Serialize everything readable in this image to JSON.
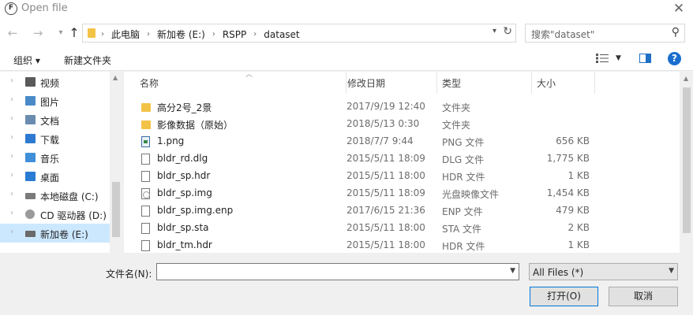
{
  "window": {
    "title": "Open file",
    "icon": "app-icon"
  },
  "address": {
    "crumbs": [
      "此电脑",
      "新加卷 (E:)",
      "RSPP",
      "dataset"
    ],
    "search_placeholder": "搜索\"dataset\""
  },
  "toolbar": {
    "organize": "组织 ▾",
    "new_folder": "新建文件夹"
  },
  "nav": {
    "items": [
      {
        "label": "视频",
        "icon": "video-folder-icon",
        "color": "#5a5a5a"
      },
      {
        "label": "图片",
        "icon": "pictures-folder-icon",
        "color": "#4a8ac9"
      },
      {
        "label": "文档",
        "icon": "documents-folder-icon",
        "color": "#6a8caf"
      },
      {
        "label": "下载",
        "icon": "downloads-folder-icon",
        "color": "#2f7ad1"
      },
      {
        "label": "音乐",
        "icon": "music-folder-icon",
        "color": "#3f8fd9"
      },
      {
        "label": "桌面",
        "icon": "desktop-folder-icon",
        "color": "#2a7bd3"
      },
      {
        "label": "本地磁盘 (C:)",
        "icon": "drive-c-icon",
        "color": "#7a7a7a"
      },
      {
        "label": "CD 驱动器 (D:)",
        "icon": "cd-drive-icon",
        "color": "#9a9a9a"
      },
      {
        "label": "新加卷 (E:)",
        "icon": "drive-e-icon",
        "color": "#6a6a6a"
      }
    ],
    "selected": "新加卷 (E:)"
  },
  "files": {
    "columns": [
      "名称",
      "修改日期",
      "类型",
      "大小"
    ],
    "rows": [
      {
        "name": "高分2号_2景",
        "date": "2017/9/19 12:40",
        "type": "文件夹",
        "size": "",
        "icon": "folder"
      },
      {
        "name": "影像数据（原始）",
        "date": "2018/5/13 0:30",
        "type": "文件夹",
        "size": "",
        "icon": "folder"
      },
      {
        "name": "1.png",
        "date": "2018/7/7 9:44",
        "type": "PNG 文件",
        "size": "656 KB",
        "icon": "png"
      },
      {
        "name": "bldr_rd.dlg",
        "date": "2015/5/11 18:09",
        "type": "DLG 文件",
        "size": "1,775 KB",
        "icon": "doc"
      },
      {
        "name": "bldr_sp.hdr",
        "date": "2015/5/11 18:00",
        "type": "HDR 文件",
        "size": "1 KB",
        "icon": "doc"
      },
      {
        "name": "bldr_sp.img",
        "date": "2015/5/11 18:09",
        "type": "光盘映像文件",
        "size": "1,454 KB",
        "icon": "img"
      },
      {
        "name": "bldr_sp.img.enp",
        "date": "2017/6/15 21:36",
        "type": "ENP 文件",
        "size": "479 KB",
        "icon": "doc"
      },
      {
        "name": "bldr_sp.sta",
        "date": "2015/5/11 18:00",
        "type": "STA 文件",
        "size": "2 KB",
        "icon": "doc"
      },
      {
        "name": "bldr_tm.hdr",
        "date": "2015/5/11 18:00",
        "type": "HDR 文件",
        "size": "1 KB",
        "icon": "doc"
      }
    ]
  },
  "footer": {
    "filename_label": "文件名(N):",
    "filename_value": "",
    "filetype": "All Files  (*)",
    "open_label": "打开(O)",
    "cancel_label": "取消"
  }
}
